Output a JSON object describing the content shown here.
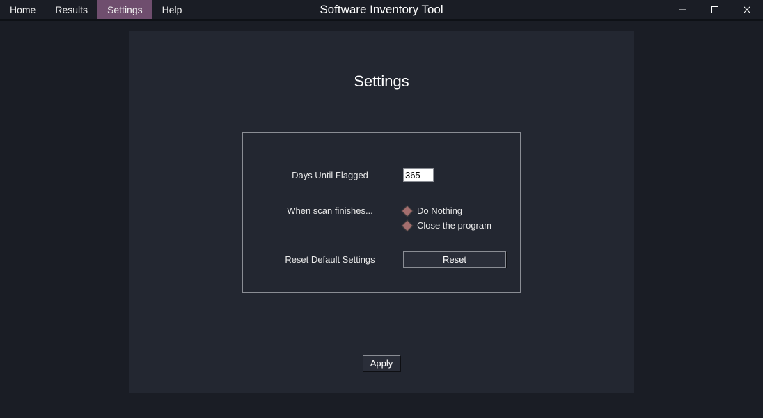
{
  "app": {
    "title": "Software Inventory Tool"
  },
  "menu": {
    "items": [
      {
        "label": "Home"
      },
      {
        "label": "Results"
      },
      {
        "label": "Settings"
      },
      {
        "label": "Help"
      }
    ],
    "active_index": 2
  },
  "settings": {
    "heading": "Settings",
    "days_label": "Days Until Flagged",
    "days_value": "365",
    "scan_finish_label": "When scan finishes...",
    "radio_do_nothing": "Do Nothing",
    "radio_close_program": "Close the program",
    "reset_label": "Reset Default Settings",
    "reset_button": "Reset",
    "apply_button": "Apply"
  }
}
